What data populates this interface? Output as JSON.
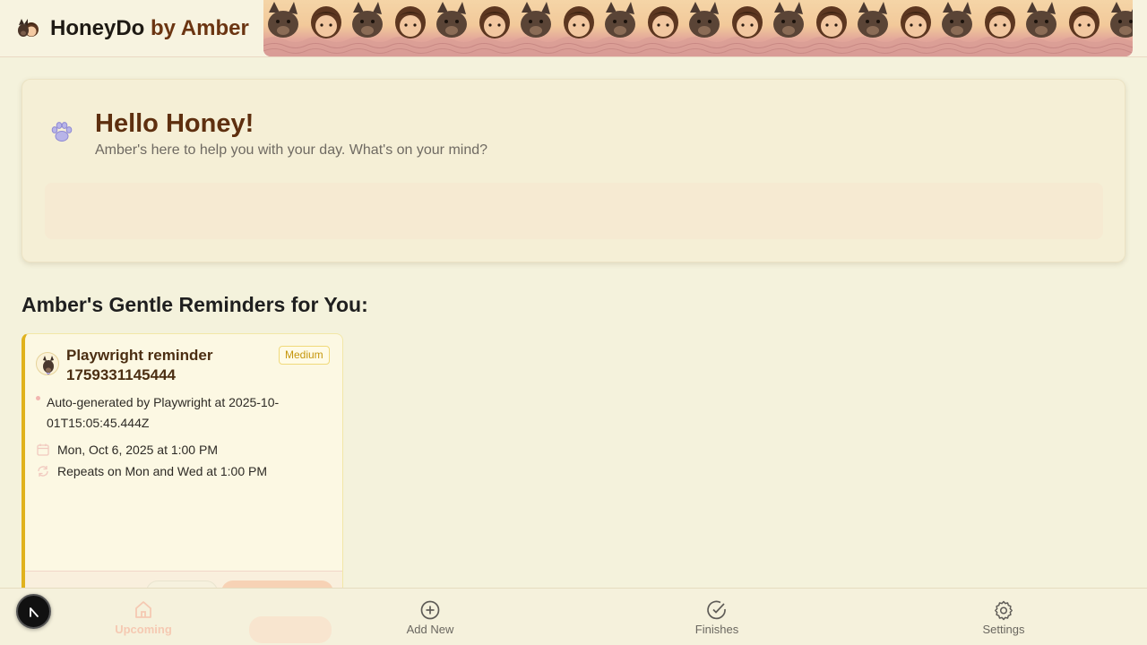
{
  "header": {
    "brand_primary": "HoneyDo",
    "brand_secondary": "by Amber",
    "logo_icon": "girl-and-dog-avatar"
  },
  "welcome": {
    "title": "Hello Honey!",
    "subtitle": "Amber's here to help you with your day. What's on your mind?",
    "icon": "paw-icon",
    "prompt_value": ""
  },
  "reminders": {
    "section_title": "Amber's Gentle Reminders for You:",
    "items": [
      {
        "title": "Playwright reminder 1759331145444",
        "priority": "Medium",
        "description": "Auto-generated by Playwright at 2025-10-01T15:05:45.444Z",
        "date": "Mon, Oct 6, 2025 at 1:00 PM",
        "repeat": "Repeats on Mon and Wed at 1:00 PM"
      }
    ]
  },
  "nav": {
    "items": [
      {
        "label": "Upcoming",
        "icon": "home-icon"
      },
      {
        "label": "Add New",
        "icon": "plus-circle-icon"
      },
      {
        "label": "Finishes",
        "icon": "check-circle-icon"
      },
      {
        "label": "Settings",
        "icon": "gear-icon"
      }
    ]
  },
  "colors": {
    "accent_brown": "#5e2f0f",
    "card_border_accent": "#e0b21d",
    "badge_text": "#c5960c",
    "page_bg": "#f4f2dc"
  }
}
